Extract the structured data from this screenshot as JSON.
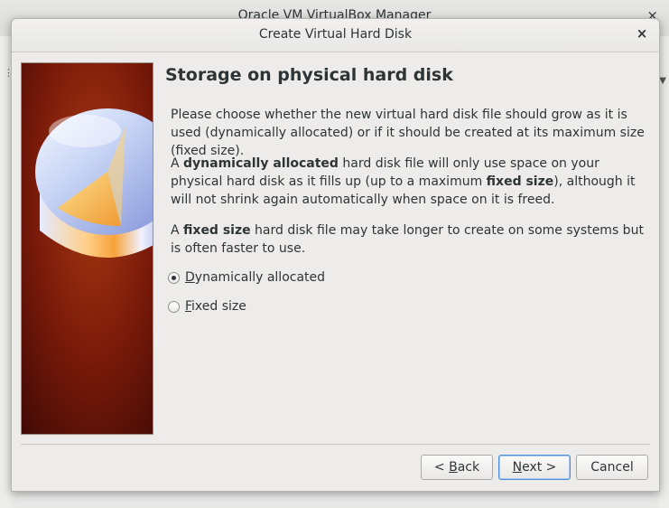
{
  "parent_window": {
    "title": "Oracle VM VirtualBox Manager",
    "close_glyph": "×"
  },
  "dialog": {
    "title": "Create Virtual Hard Disk",
    "close_glyph": "×"
  },
  "page": {
    "heading": "Storage on physical hard disk",
    "paragraph1": "Please choose whether the new virtual hard disk file should grow as it is used (dynamically allocated) or if it should be created at its maximum size (fixed size).",
    "paragraph2": {
      "pre": "A ",
      "bold1": "dynamically allocated",
      "mid": " hard disk file will only use space on your physical hard disk as it fills up (up to a maximum ",
      "bold2": "fixed size",
      "post": "), although it will not shrink again automatically when space on it is freed."
    },
    "paragraph3": {
      "pre": "A ",
      "bold": "fixed size",
      "post": " hard disk file may take longer to create on some systems but is often faster to use."
    }
  },
  "options": [
    {
      "mnemonic": "D",
      "rest": "ynamically allocated",
      "selected": true
    },
    {
      "mnemonic": "F",
      "rest": "ixed size",
      "selected": false
    }
  ],
  "buttons": {
    "back": {
      "prefix": "< ",
      "mnemonic": "B",
      "rest": "ack"
    },
    "next": {
      "mnemonic": "N",
      "rest": "ext >"
    },
    "cancel": "Cancel"
  },
  "icons": {
    "wizard_image": "hard-disk-illustration-icon",
    "close": "close-icon"
  },
  "colors": {
    "image_background": "#7a1a0a",
    "focus_border": "#4a90d9"
  }
}
